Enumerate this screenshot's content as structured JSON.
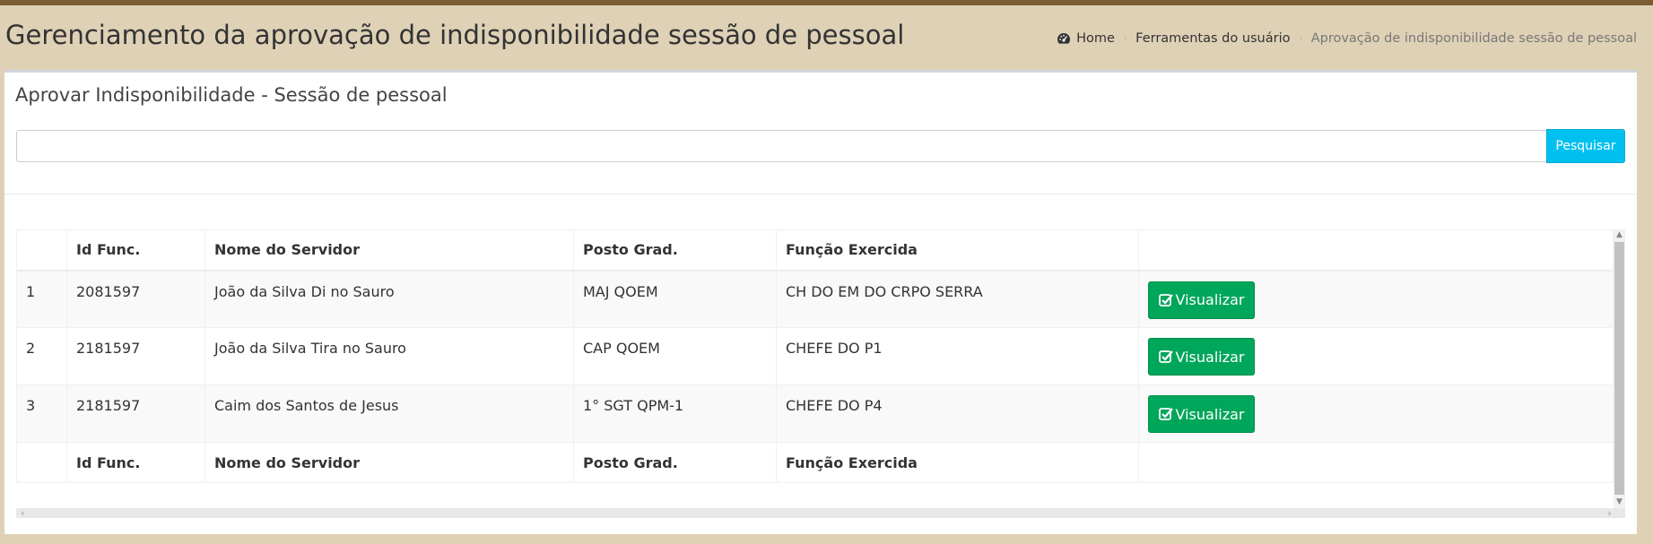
{
  "page": {
    "title": "Gerenciamento da aprovação de indisponibilidade sessão de pessoal"
  },
  "breadcrumb": {
    "items": [
      {
        "label": "Home",
        "icon": "dashboard-icon"
      },
      {
        "label": "Ferramentas do usuário"
      },
      {
        "label": "Aprovação de indisponibilidade sessão de pessoal"
      }
    ]
  },
  "panel": {
    "title": "Aprovar Indisponibilidade - Sessão de pessoal"
  },
  "search": {
    "value": "",
    "placeholder": "",
    "button_label": "Pesquisar"
  },
  "table": {
    "columns": [
      "",
      "Id Func.",
      "Nome do Servidor",
      "Posto Grad.",
      "Função Exercida",
      ""
    ],
    "rows": [
      {
        "num": "1",
        "id": "2081597",
        "name": "João da Silva Di no Sauro",
        "rank": "MAJ QOEM",
        "role": "CH DO EM DO CRPO SERRA",
        "action": "Visualizar"
      },
      {
        "num": "2",
        "id": "2181597",
        "name": "João da Silva Tira no Sauro",
        "rank": "CAP QOEM",
        "role": "CHEFE DO P1",
        "action": "Visualizar"
      },
      {
        "num": "3",
        "id": "2181597",
        "name": "Caim dos Santos de Jesus",
        "rank": "1° SGT QPM-1",
        "role": "CHEFE DO P4",
        "action": "Visualizar"
      }
    ]
  },
  "colors": {
    "background": "#dfd1b6",
    "top_border": "#7a5e32",
    "search_button": "#00c0ef",
    "view_button": "#00a65a"
  }
}
